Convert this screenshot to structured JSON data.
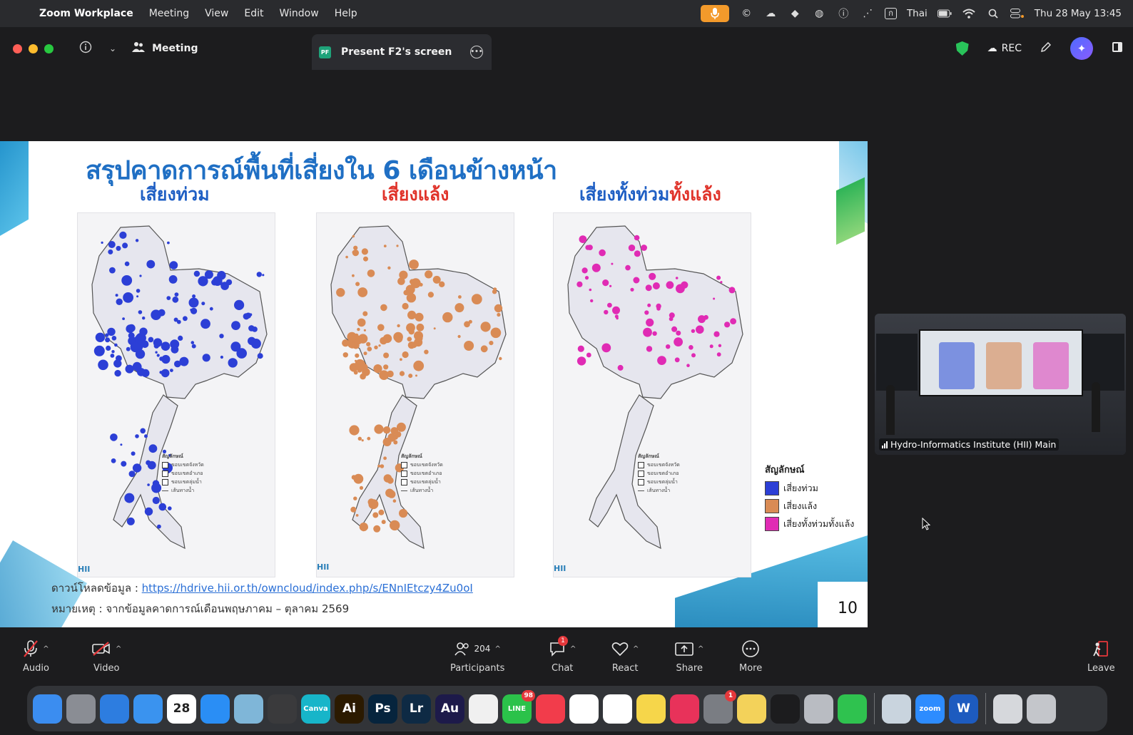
{
  "menubar": {
    "app_name": "Zoom Workplace",
    "items": [
      "Meeting",
      "View",
      "Edit",
      "Window",
      "Help"
    ],
    "input_source": "Thai",
    "input_source_letter": "ก",
    "datetime": "Thu 28 May  13:45"
  },
  "titlebar": {
    "meeting_label": "Meeting",
    "present_tab_label": "Present F2's screen",
    "present_badge": "PF",
    "rec_label": "REC"
  },
  "slide": {
    "title": "สรุปคาดการณ์พื้นที่เสี่ยงใน 6 เดือนข้างหน้า",
    "sub_flood": "เสี่ยงท่วม",
    "sub_drought": "เสี่ยงแล้ง",
    "sub_both_a": "เสี่ยงทั้งท่วม",
    "sub_both_b": "ทั้งแล้ง",
    "map_legend": {
      "title": "สัญลักษณ์",
      "items": [
        "ขอบเขตจังหวัด",
        "ขอบเขตอำเภอ",
        "ขอบเขตลุ่มน้ำ",
        "เส้นทางน้ำ"
      ]
    },
    "hii_logo": "HII",
    "legend": {
      "title": "สัญลักษณ์",
      "items": [
        {
          "label": "เสี่ยงท่วม",
          "color": "#2c3fd6"
        },
        {
          "label": "เสี่ยงแล้ง",
          "color": "#d98b55"
        },
        {
          "label": "เสี่ยงทั้งท่วมทั้งแล้ง",
          "color": "#e02bb4"
        }
      ]
    },
    "download_prefix": "ดาวน์โหลดข้อมูล :",
    "download_url": "https://hdrive.hii.or.th/owncloud/index.php/s/ENnIEtczy4Zu0oI",
    "note": "หมายเหตุ : จากข้อมูลคาดการณ์เดือนพฤษภาคม – ตุลาคม 2569",
    "page_number": "10",
    "colors": {
      "flood": "#2c3fd6",
      "drought": "#d98b55",
      "both": "#e02bb4"
    }
  },
  "video_tile": {
    "caption": "Hydro-Informatics Institute (HII) Main"
  },
  "toolbar": {
    "audio": "Audio",
    "video": "Video",
    "participants": "Participants",
    "participants_count": "204",
    "chat": "Chat",
    "chat_badge": "1",
    "react": "React",
    "share": "Share",
    "more": "More",
    "leave": "Leave"
  },
  "dock": {
    "apps": [
      {
        "name": "finder-icon",
        "label": "",
        "color": "#3b8df0"
      },
      {
        "name": "launchpad-icon",
        "label": "",
        "color": "#8a8d94"
      },
      {
        "name": "safari-icon",
        "label": "",
        "color": "#2d7de0"
      },
      {
        "name": "mail-icon",
        "label": "",
        "color": "#3a93ef"
      },
      {
        "name": "calendar-icon",
        "label": "28",
        "color": "#ffffff"
      },
      {
        "name": "app-store-icon",
        "label": "",
        "color": "#2a8ef5"
      },
      {
        "name": "preview-icon",
        "label": "",
        "color": "#7fb6d8"
      },
      {
        "name": "calculator-icon",
        "label": "",
        "color": "#3a3a3c"
      },
      {
        "name": "canva-icon",
        "label": "Canva",
        "color": "#17b5c9"
      },
      {
        "name": "illustrator-icon",
        "label": "Ai",
        "color": "#2b1a00"
      },
      {
        "name": "photoshop-icon",
        "label": "Ps",
        "color": "#06243d"
      },
      {
        "name": "lightroom-icon",
        "label": "Lr",
        "color": "#0e2a44"
      },
      {
        "name": "audition-icon",
        "label": "Au",
        "color": "#1d1a4a"
      },
      {
        "name": "photos-icon",
        "label": "",
        "color": "#f0f0f0"
      },
      {
        "name": "line-icon",
        "label": "LINE",
        "color": "#2bc24a"
      },
      {
        "name": "music-icon",
        "label": "",
        "color": "#f23c4b"
      },
      {
        "name": "chrome-icon",
        "label": "",
        "color": "#ffffff"
      },
      {
        "name": "reminders-icon",
        "label": "",
        "color": "#ffffff"
      },
      {
        "name": "notes-icon",
        "label": "",
        "color": "#f6d64a"
      },
      {
        "name": "creative-cloud-icon",
        "label": "",
        "color": "#e8325a"
      },
      {
        "name": "system-settings-icon",
        "label": "",
        "color": "#7a7d83"
      },
      {
        "name": "stickies-icon",
        "label": "",
        "color": "#f3d25a"
      },
      {
        "name": "quicktime-icon",
        "label": "",
        "color": "#1c1c1e"
      },
      {
        "name": "iphone-mirroring-icon",
        "label": "",
        "color": "#b9bcc2"
      },
      {
        "name": "facetime-icon",
        "label": "",
        "color": "#2fc24f"
      },
      {
        "name": "preview-doc-icon",
        "label": "",
        "color": "#c9d4de"
      },
      {
        "name": "zoom-icon",
        "label": "zoom",
        "color": "#2d8cff"
      },
      {
        "name": "word-icon",
        "label": "W",
        "color": "#1d5bbf"
      },
      {
        "name": "scanner-icon",
        "label": "",
        "color": "#d6d8dc"
      },
      {
        "name": "trash-icon",
        "label": "",
        "color": "#c4c6cb"
      }
    ],
    "line_badge": "98",
    "settings_badge": "1"
  }
}
